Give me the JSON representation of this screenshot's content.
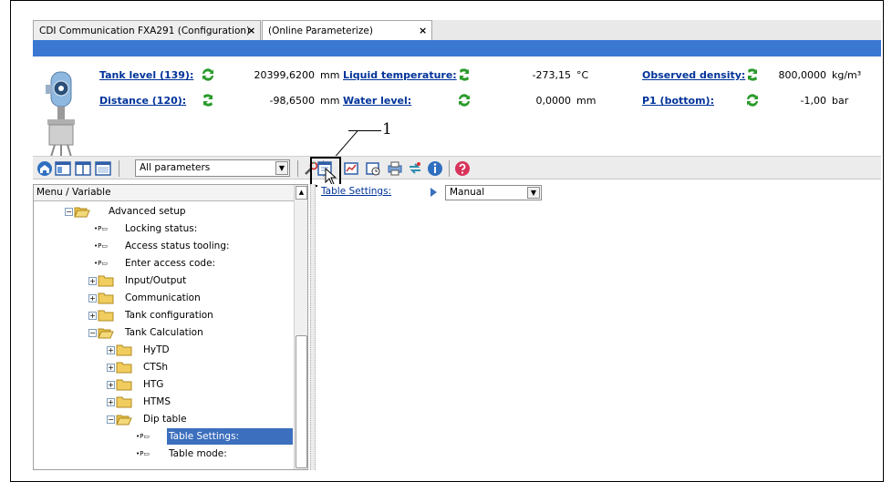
{
  "tabs": [
    {
      "label": "CDI Communication FXA291 (Configuration)",
      "close": "×"
    },
    {
      "label": "(Online Parameterize)",
      "close": "×"
    }
  ],
  "header": {
    "values": [
      {
        "label": "Tank level (139):",
        "value": "20399,6200",
        "unit": "mm"
      },
      {
        "label": "Distance (120):",
        "value": "-98,6500",
        "unit": "mm"
      },
      {
        "label": "Liquid temperature:",
        "value": "-273,15",
        "unit": "°C"
      },
      {
        "label": "Water level:",
        "value": "0,0000",
        "unit": "mm"
      },
      {
        "label": "Observed density:",
        "value": "800,0000",
        "unit": "kg/m³"
      },
      {
        "label": "P1 (bottom):",
        "value": "-1,00",
        "unit": "bar"
      }
    ]
  },
  "callout": "1",
  "toolbar": {
    "filter_value": "All parameters",
    "icons": [
      "home-icon",
      "view-layout-1-icon",
      "view-layout-2-icon",
      "view-layout-3-icon",
      "wrench-icon",
      "table-settings-icon",
      "chart-icon",
      "clock-icon",
      "print-icon",
      "compare-icon",
      "info-icon",
      "help-icon"
    ]
  },
  "tree": {
    "header": "Menu / Variable",
    "items": [
      {
        "label": "Advanced setup",
        "type": "folder-open"
      },
      {
        "label": "Locking status:",
        "type": "param"
      },
      {
        "label": "Access status tooling:",
        "type": "param"
      },
      {
        "label": "Enter access code:",
        "type": "param"
      },
      {
        "label": "Input/Output",
        "type": "folder"
      },
      {
        "label": "Communication",
        "type": "folder"
      },
      {
        "label": "Tank configuration",
        "type": "folder"
      },
      {
        "label": "Tank Calculation",
        "type": "folder-open"
      },
      {
        "label": "HyTD",
        "type": "folder"
      },
      {
        "label": "CTSh",
        "type": "folder"
      },
      {
        "label": "HTG",
        "type": "folder"
      },
      {
        "label": "HTMS",
        "type": "folder"
      },
      {
        "label": "Dip table",
        "type": "folder-open"
      },
      {
        "label": "Table Settings:",
        "type": "param",
        "selected": true
      },
      {
        "label": "Table mode:",
        "type": "param"
      }
    ]
  },
  "detail": {
    "label": "Table Settings:",
    "value": "Manual"
  },
  "colors": {
    "accent": "#3a78d2",
    "link": "#003399",
    "selection": "#3c6fbd"
  }
}
